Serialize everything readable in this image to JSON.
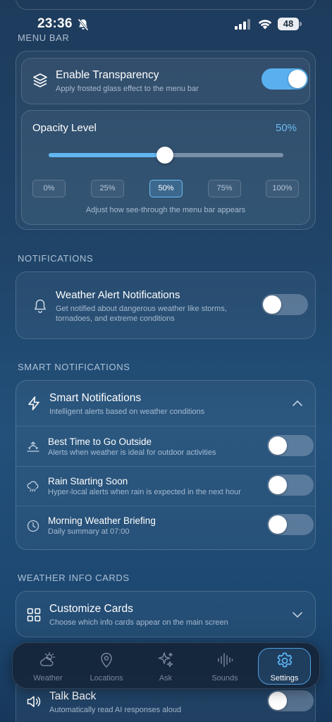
{
  "status_bar": {
    "time": "23:36",
    "battery": "48"
  },
  "colors": {
    "accent": "#5ab0ee",
    "background": "#1f4468",
    "toggle_off": "#7f8ea5"
  },
  "menu_bar": {
    "section_title": "MENU BAR",
    "transparency": {
      "title": "Enable Transparency",
      "description": "Apply frosted glass effect to the menu bar",
      "enabled": true
    },
    "opacity": {
      "title": "Opacity Level",
      "value_label": "50%",
      "value": 50,
      "presets": [
        "0%",
        "25%",
        "50%",
        "75%",
        "100%"
      ],
      "selected_preset": "50%",
      "hint": "Adjust how see-through the menu bar appears"
    }
  },
  "notifications": {
    "section_title": "NOTIFICATIONS",
    "weather_alert": {
      "title": "Weather Alert Notifications",
      "description_line1": "Get notified about dangerous weather like storms,",
      "description_line2": "tornadoes, and extreme conditions",
      "enabled": false
    }
  },
  "smart_notifications": {
    "section_title": "SMART NOTIFICATIONS",
    "header": {
      "title": "Smart Notifications",
      "description": "Intelligent alerts based on weather conditions",
      "expanded": true
    },
    "items": [
      {
        "title": "Best Time to Go Outside",
        "description": "Alerts when weather is ideal for outdoor activities",
        "enabled": false
      },
      {
        "title": "Rain Starting Soon",
        "description": "Hyper-local alerts when rain is expected in the next hour",
        "enabled": false
      },
      {
        "title": "Morning Weather Briefing",
        "description": "Daily summary at 07:00",
        "enabled": false
      }
    ]
  },
  "weather_info_cards": {
    "section_title": "WEATHER INFO CARDS",
    "customize": {
      "title": "Customize Cards",
      "description": "Choose which info cards appear on the main screen",
      "expanded": false
    }
  },
  "talk_back": {
    "title": "Talk Back",
    "description": "Automatically read AI responses aloud",
    "enabled": false
  },
  "tab_bar": {
    "tabs": [
      {
        "label": "Weather",
        "icon": "weather-icon"
      },
      {
        "label": "Locations",
        "icon": "location-pin-icon"
      },
      {
        "label": "Ask",
        "icon": "sparkle-icon"
      },
      {
        "label": "Sounds",
        "icon": "waveform-icon"
      },
      {
        "label": "Settings",
        "icon": "gear-icon"
      }
    ],
    "active": "Settings"
  }
}
